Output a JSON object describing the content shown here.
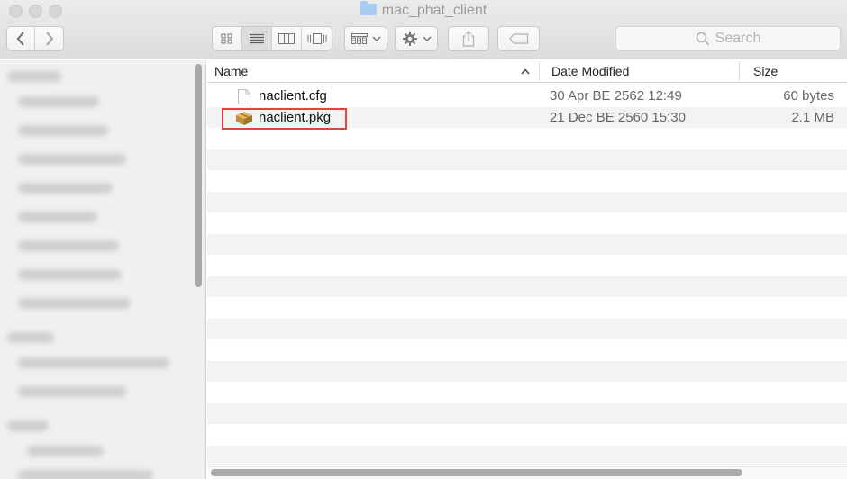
{
  "window": {
    "title": "mac_phat_client"
  },
  "toolbar": {
    "back_icon": "chevron-left-icon",
    "forward_icon": "chevron-right-icon",
    "view_icons": [
      "icon-view-icon",
      "list-view-icon",
      "column-view-icon",
      "cover-flow-icon"
    ],
    "arrange_icon": "arrange-grid-icon",
    "action_icon": "gear-icon",
    "share_icon": "share-icon",
    "tag_icon": "tag-icon"
  },
  "search": {
    "placeholder": "Search"
  },
  "columns": {
    "name": "Name",
    "date": "Date Modified",
    "size": "Size"
  },
  "files": [
    {
      "name": "naclient.cfg",
      "date": "30 Apr BE 2562 12:49",
      "size": "60 bytes",
      "icon": "document-icon"
    },
    {
      "name": "naclient.pkg",
      "date": "21 Dec BE 2560 15:30",
      "size": "2.1 MB",
      "icon": "package-icon",
      "highlighted": true
    }
  ],
  "colors": {
    "highlight": "#e0463f",
    "folder": "#a6cdf1",
    "row_alt": "#f3f3f3"
  }
}
